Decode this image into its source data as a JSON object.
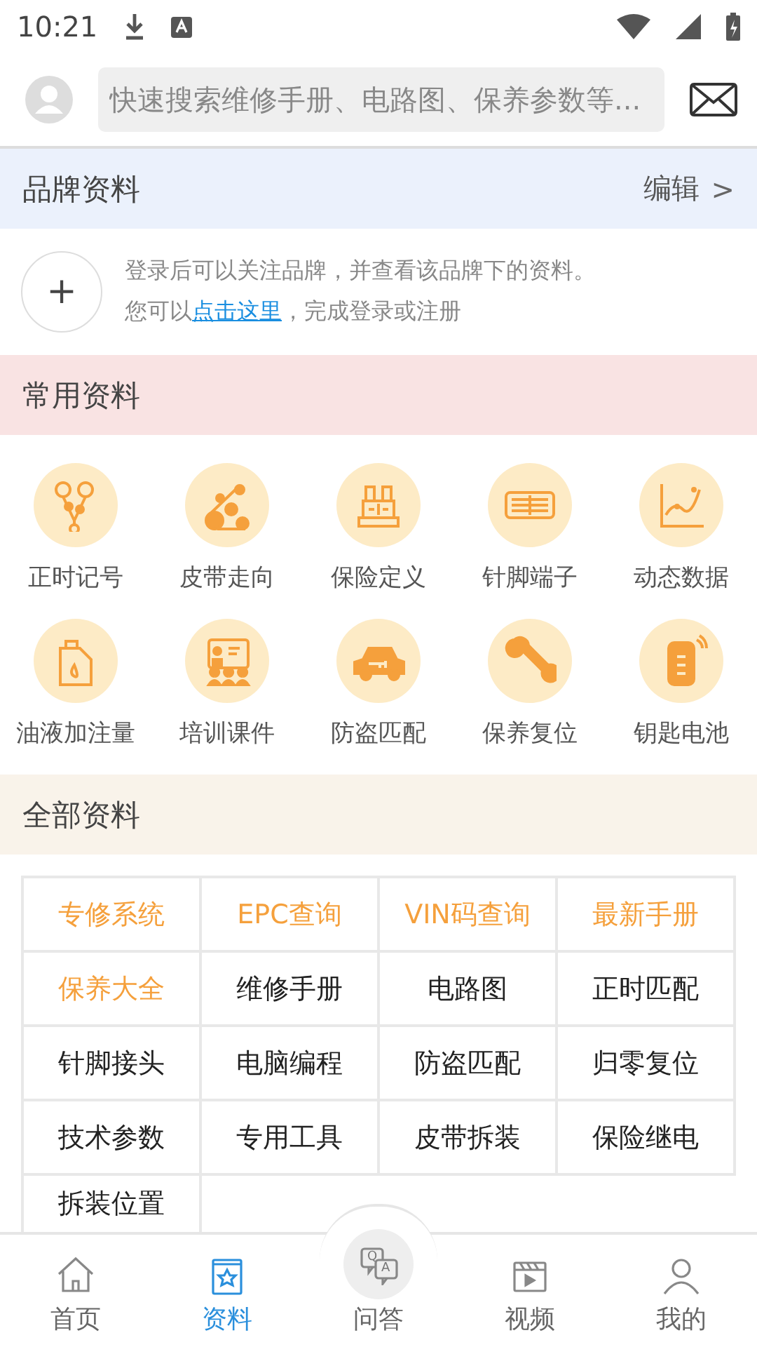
{
  "status_bar": {
    "time": "10:21"
  },
  "header": {
    "search": {
      "placeholder": "快速搜索维修手册、电路图、保养参数等..."
    }
  },
  "brand_section": {
    "title": "品牌资料",
    "action": "编辑",
    "action_icon": ">",
    "add_icon": "+",
    "message_line1": "登录后可以关注品牌，并查看该品牌下的资料。",
    "message_line2_before": "您可以",
    "message_link": "点击这里",
    "message_line2_after": "，完成登录或注册"
  },
  "common_section": {
    "title": "常用资料",
    "items": [
      {
        "label": "正时记号",
        "kind": "timing"
      },
      {
        "label": "皮带走向",
        "kind": "belt"
      },
      {
        "label": "保险定义",
        "kind": "fuse"
      },
      {
        "label": "针脚端子",
        "kind": "connector"
      },
      {
        "label": "动态数据",
        "kind": "chart"
      },
      {
        "label": "油液加注量",
        "kind": "oil"
      },
      {
        "label": "培训课件",
        "kind": "training"
      },
      {
        "label": "防盗匹配",
        "kind": "carkey"
      },
      {
        "label": "保养复位",
        "kind": "wrench"
      },
      {
        "label": "钥匙电池",
        "kind": "fob"
      }
    ]
  },
  "all_section": {
    "title": "全部资料",
    "items": [
      {
        "label": "专修系统",
        "highlighted": true
      },
      {
        "label": "EPC查询",
        "highlighted": true
      },
      {
        "label": "VIN码查询",
        "highlighted": true
      },
      {
        "label": "最新手册",
        "highlighted": true
      },
      {
        "label": "保养大全",
        "highlighted": true
      },
      {
        "label": "维修手册",
        "highlighted": false
      },
      {
        "label": "电路图",
        "highlighted": false
      },
      {
        "label": "正时匹配",
        "highlighted": false
      },
      {
        "label": "针脚接头",
        "highlighted": false
      },
      {
        "label": "电脑编程",
        "highlighted": false
      },
      {
        "label": "防盗匹配",
        "highlighted": false
      },
      {
        "label": "归零复位",
        "highlighted": false
      },
      {
        "label": "技术参数",
        "highlighted": false
      },
      {
        "label": "专用工具",
        "highlighted": false
      },
      {
        "label": "皮带拆装",
        "highlighted": false
      },
      {
        "label": "保险继电",
        "highlighted": false
      },
      {
        "label": "拆装位置",
        "highlighted": false
      }
    ]
  },
  "bottom_nav": [
    {
      "label": "首页",
      "kind": "home",
      "selected": false
    },
    {
      "label": "资料",
      "kind": "book",
      "selected": true
    },
    {
      "label": "问答",
      "kind": "qa",
      "selected": false,
      "icon_letters": [
        "Q",
        "A"
      ]
    },
    {
      "label": "视频",
      "kind": "video",
      "selected": false
    },
    {
      "label": "我的",
      "kind": "user",
      "selected": false
    }
  ]
}
